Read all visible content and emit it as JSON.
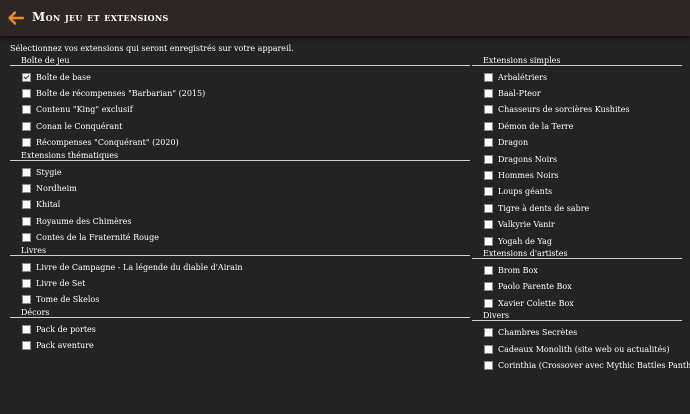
{
  "header": {
    "title": "Mon jeu et extensions",
    "back_icon": "arrow-left-icon",
    "accent": "#f08a1c"
  },
  "intro": "Sélectionnez vos extensions qui seront enregistrés sur votre appareil.",
  "left_sections": [
    {
      "title": "Boîte de jeu",
      "items": [
        {
          "label": "Boîte de base",
          "checked": true
        },
        {
          "label": "Boîte de récompenses \"Barbarian\" (2015)",
          "checked": false
        },
        {
          "label": "Contenu \"King\" exclusif",
          "checked": false
        },
        {
          "label": "Conan le Conquérant",
          "checked": false
        },
        {
          "label": "Récompenses \"Conquérant\" (2020)",
          "checked": false
        }
      ]
    },
    {
      "title": "Extensions thématiques",
      "items": [
        {
          "label": "Stygie",
          "checked": false
        },
        {
          "label": "Nordheim",
          "checked": false
        },
        {
          "label": "Khitaï",
          "checked": false
        },
        {
          "label": "Royaume des Chimères",
          "checked": false
        },
        {
          "label": "Contes de la Fraternité Rouge",
          "checked": false
        }
      ]
    },
    {
      "title": "Livres",
      "items": [
        {
          "label": "Livre de Campagne - La légende du diable d'Airain",
          "checked": false
        },
        {
          "label": "Livre de Set",
          "checked": false
        },
        {
          "label": "Tome de Skelos",
          "checked": false
        }
      ]
    },
    {
      "title": "Décors",
      "items": [
        {
          "label": "Pack de portes",
          "checked": false
        },
        {
          "label": "Pack aventure",
          "checked": false
        }
      ]
    }
  ],
  "right_sections": [
    {
      "title": "Extensions simples",
      "items": [
        {
          "label": "Arbalétriers",
          "checked": false
        },
        {
          "label": "Baal-Pteor",
          "checked": false
        },
        {
          "label": "Chasseurs de sorcières Kushites",
          "checked": false
        },
        {
          "label": "Démon de la Terre",
          "checked": false
        },
        {
          "label": "Dragon",
          "checked": false
        },
        {
          "label": "Dragons Noirs",
          "checked": false
        },
        {
          "label": "Hommes Noirs",
          "checked": false
        },
        {
          "label": "Loups géants",
          "checked": false
        },
        {
          "label": "Tigre à dents de sabre",
          "checked": false
        },
        {
          "label": "Valkyrie Vanir",
          "checked": false
        },
        {
          "label": "Yogah de Yag",
          "checked": false
        }
      ]
    },
    {
      "title": "Extensions d'artistes",
      "items": [
        {
          "label": "Brom Box",
          "checked": false
        },
        {
          "label": "Paolo Parente Box",
          "checked": false
        },
        {
          "label": "Xavier Colette Box",
          "checked": false
        }
      ]
    },
    {
      "title": "Divers",
      "items": [
        {
          "label": "Chambres Secrètes",
          "checked": false
        },
        {
          "label": "Cadeaux Monolith (site web ou actualités)",
          "checked": false
        },
        {
          "label": "Corinthia (Crossover avec Mythic Battles Panthéon)",
          "checked": false
        }
      ]
    }
  ]
}
